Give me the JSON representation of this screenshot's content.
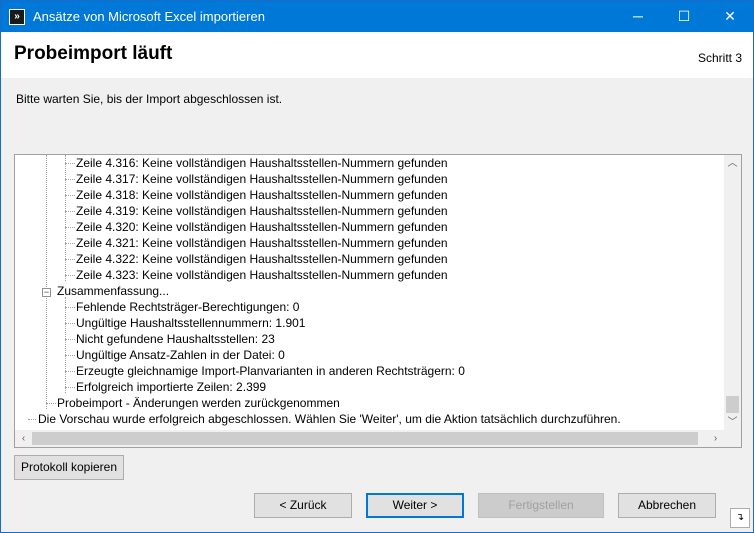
{
  "window": {
    "title": "Ansätze von Microsoft Excel importieren",
    "icon": "import-arrows-icon",
    "minimize_glyph": "─",
    "maximize_glyph": "☐",
    "close_glyph": "✕"
  },
  "header": {
    "title": "Probeimport läuft",
    "step": "Schritt 3"
  },
  "instruction": "Bitte warten Sie, bis der Import abgeschlossen ist.",
  "log": {
    "row_lines": [
      "Zeile 4.316: Keine vollständigen Haushaltsstellen-Nummern gefunden",
      "Zeile 4.317: Keine vollständigen Haushaltsstellen-Nummern gefunden",
      "Zeile 4.318: Keine vollständigen Haushaltsstellen-Nummern gefunden",
      "Zeile 4.319: Keine vollständigen Haushaltsstellen-Nummern gefunden",
      "Zeile 4.320: Keine vollständigen Haushaltsstellen-Nummern gefunden",
      "Zeile 4.321: Keine vollständigen Haushaltsstellen-Nummern gefunden",
      "Zeile 4.322: Keine vollständigen Haushaltsstellen-Nummern gefunden",
      "Zeile 4.323: Keine vollständigen Haushaltsstellen-Nummern gefunden"
    ],
    "summary_label": "Zusammenfassung...",
    "summary_items": [
      "Fehlende Rechtsträger-Berechtigungen: 0",
      "Ungültige Haushaltsstellennummern: 1.901",
      "Nicht gefundene Haushaltsstellen: 23",
      "Ungültige Ansatz-Zahlen in der Datei: 0",
      "Erzeugte gleichnamige Import-Planvarianten in anderen Rechtsträgern: 0",
      "Erfolgreich importierte Zeilen: 2.399"
    ],
    "rollback_line": "Probeimport - Änderungen werden zurückgenommen",
    "final_line": "Die Vorschau wurde erfolgreich abgeschlossen. Wählen Sie 'Weiter', um die Aktion tatsächlich durchzuführen."
  },
  "buttons": {
    "copy_log": "Protokoll kopieren",
    "back": "< Zurück",
    "next": "Weiter >",
    "finish": "Fertigstellen",
    "cancel": "Abbrechen"
  }
}
